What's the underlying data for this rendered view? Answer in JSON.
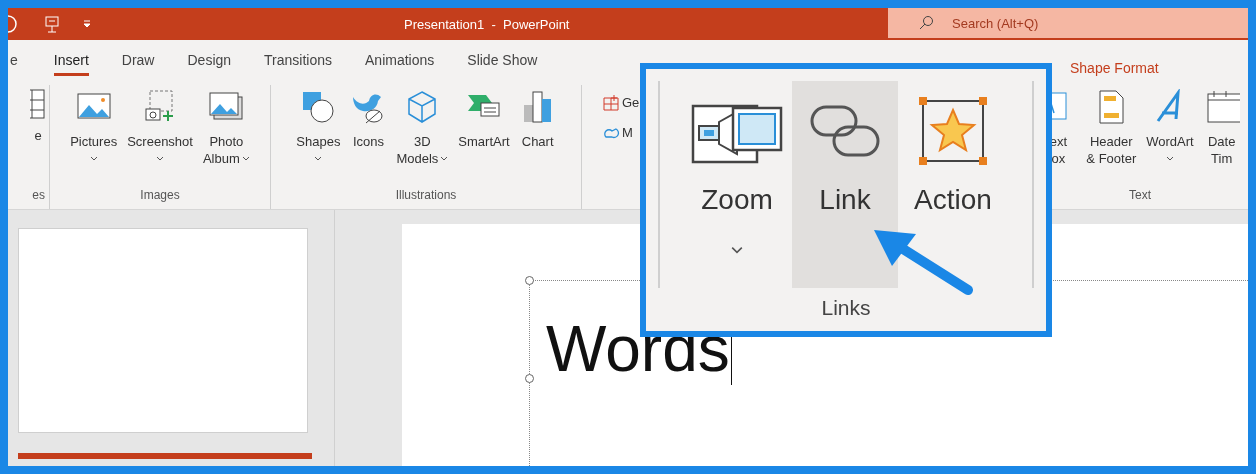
{
  "window": {
    "title": "Presentation1  -  PowerPoint"
  },
  "search": {
    "placeholder": "Search (Alt+Q)"
  },
  "tabs": [
    {
      "label": "e",
      "selected": false
    },
    {
      "label": "Insert",
      "selected": true
    },
    {
      "label": "Draw",
      "selected": false
    },
    {
      "label": "Design",
      "selected": false
    },
    {
      "label": "Transitions",
      "selected": false
    },
    {
      "label": "Animations",
      "selected": false
    },
    {
      "label": "Slide Show",
      "selected": false
    }
  ],
  "contextual_tab": {
    "label": "Shape Format"
  },
  "ribbon_groups": [
    {
      "label": "es",
      "buttons": [
        {
          "kind": "table",
          "lines": [
            "e"
          ],
          "dropdown": false
        }
      ]
    },
    {
      "label": "Images",
      "buttons": [
        {
          "kind": "pictures",
          "lines": [
            "Pictures"
          ],
          "dropdown": true
        },
        {
          "kind": "screenshot",
          "lines": [
            "Screenshot"
          ],
          "dropdown": true
        },
        {
          "kind": "album",
          "lines": [
            "Photo",
            "Album"
          ],
          "dropdown": true
        }
      ]
    },
    {
      "label": "Illustrations",
      "buttons": [
        {
          "kind": "shapes",
          "lines": [
            "Shapes"
          ],
          "dropdown": true
        },
        {
          "kind": "icons",
          "lines": [
            "Icons"
          ],
          "dropdown": false
        },
        {
          "kind": "cube",
          "lines": [
            "3D",
            "Models"
          ],
          "dropdown": true
        },
        {
          "kind": "smartart",
          "lines": [
            "SmartArt"
          ],
          "dropdown": false
        },
        {
          "kind": "chart",
          "lines": [
            "Chart"
          ],
          "dropdown": false
        }
      ]
    },
    {
      "small_buttons": [
        {
          "kind": "grid",
          "label": "Ge"
        },
        {
          "kind": "loop",
          "label": "M"
        }
      ]
    },
    {
      "label": "Text",
      "buttons": [
        {
          "kind": "textbox",
          "lines": [
            "ext",
            "ox"
          ],
          "dropdown": false
        },
        {
          "kind": "header",
          "lines": [
            "Header",
            "& Footer"
          ],
          "dropdown": false
        },
        {
          "kind": "wordart",
          "lines": [
            "WordArt"
          ],
          "dropdown": true
        },
        {
          "kind": "date",
          "lines": [
            "Date",
            "Tim"
          ],
          "dropdown": false
        }
      ]
    }
  ],
  "callout": {
    "buttons": [
      {
        "kind": "zoom",
        "label": "Zoom",
        "dropdown": true,
        "selected": false
      },
      {
        "kind": "link",
        "label": "Link",
        "dropdown": false,
        "selected": true
      },
      {
        "kind": "action",
        "label": "Action",
        "dropdown": false,
        "selected": false
      }
    ],
    "group_label": "Links"
  },
  "slide": {
    "text": "Words"
  }
}
